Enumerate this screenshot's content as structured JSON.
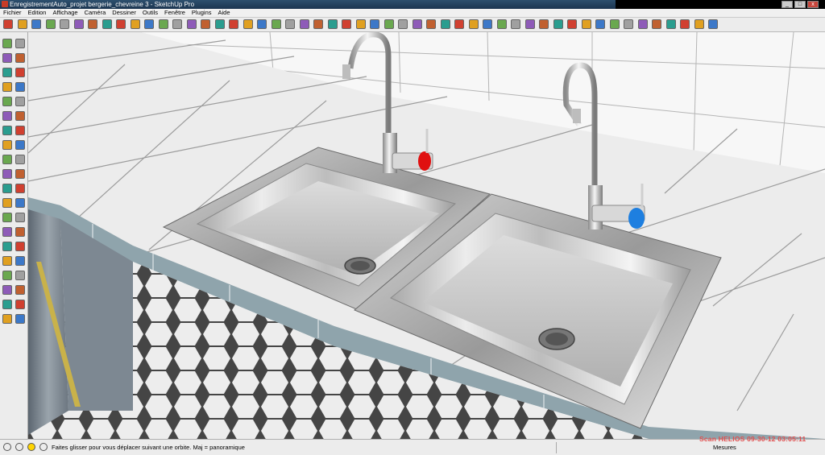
{
  "window": {
    "title": "EnregistrementAuto_projet bergerie_chevreine 3 - SketchUp Pro"
  },
  "menu": [
    "Fichier",
    "Edition",
    "Affichage",
    "Caméra",
    "Dessiner",
    "Outils",
    "Fenêtre",
    "Plugins",
    "Aide"
  ],
  "toolbar_icons": [
    "select-icon",
    "pencil-icon",
    "rectangle-icon",
    "circle-icon",
    "arc-icon",
    "eraser-icon",
    "paint-bucket-icon",
    "push-pull-icon",
    "move-icon",
    "rotate-icon",
    "follow-me-icon",
    "scale-icon",
    "offset-icon",
    "tape-measure-icon",
    "protractor-icon",
    "axes-icon",
    "dimension-icon",
    "text-icon",
    "3d-text-icon",
    "orbit-icon",
    "pan-icon",
    "zoom-icon",
    "zoom-window-icon",
    "zoom-extents-icon",
    "previous-view-icon",
    "walk-icon",
    "look-around-icon",
    "position-camera-icon",
    "section-plane-icon",
    "components-icon",
    "3d-warehouse-icon",
    "share-model-icon",
    "get-photo-texture-icon",
    "iso-view-icon",
    "top-view-icon",
    "front-view-icon",
    "right-view-icon",
    "back-view-icon",
    "left-view-icon",
    "xray-icon",
    "wireframe-icon",
    "hidden-line-icon",
    "shaded-icon",
    "shaded-textures-icon",
    "monochrome-icon",
    "shadows-icon",
    "fog-icon",
    "edge-style-icon",
    "layer-icon",
    "plugin-tools-icon",
    "ruby-console-icon"
  ],
  "status": {
    "text": "Faites glisser pour vous déplacer suivant une orbite.  Maj = panoramique",
    "measure_label": "Mesures"
  },
  "watermark": "Scan HELIOS 09-30-12 03:05:11",
  "colors": {
    "hot_tap": "#e01010",
    "cold_tap": "#1e7fe0"
  }
}
